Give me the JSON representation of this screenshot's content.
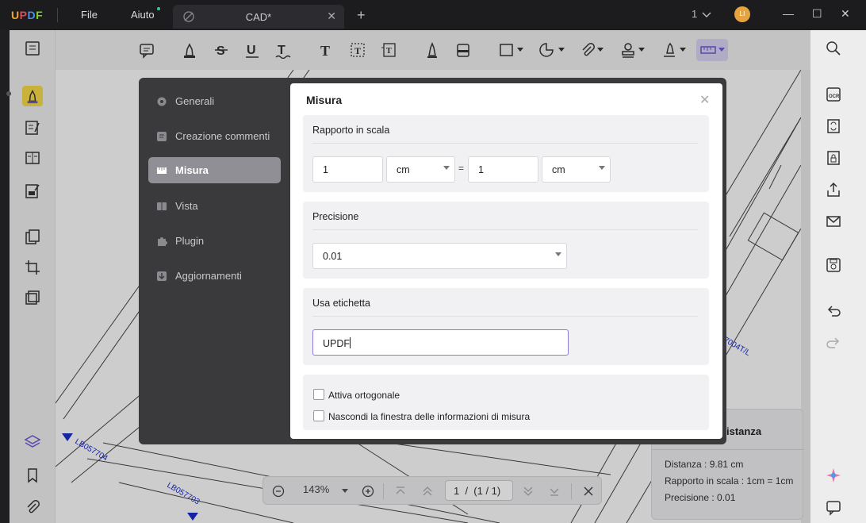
{
  "titlebar": {
    "logo": [
      "U",
      "P",
      "D",
      "F"
    ],
    "menu": [
      "File",
      "Aiuto"
    ],
    "tab_title": "CAD*",
    "page_indicator": "1",
    "avatar_initials": "LI"
  },
  "settings": {
    "nav": [
      {
        "label": "Generali"
      },
      {
        "label": "Creazione commenti"
      },
      {
        "label": "Misura"
      },
      {
        "label": "Vista"
      },
      {
        "label": "Plugin"
      },
      {
        "label": "Aggiornamenti"
      }
    ],
    "active": "Misura"
  },
  "misura": {
    "title": "Misura",
    "scale_section": "Rapporto in scala",
    "scale_left_value": "1",
    "scale_left_unit": "cm",
    "equals": "=",
    "scale_right_value": "1",
    "scale_right_unit": "cm",
    "precision_section": "Precisione",
    "precision_value": "0.01",
    "label_section": "Usa etichetta",
    "label_value": "UPDF",
    "checkbox_orthogonal": "Attiva ortogonale",
    "checkbox_hide_info": "Nascondi la finestra delle informazioni di misura"
  },
  "info_panel": {
    "title": "istanza",
    "distance": "Distanza : 9.81 cm",
    "scale": "Rapporto in scala : 1cm = 1cm",
    "precision": "Precisione : 0.01"
  },
  "bottomnav": {
    "zoom": "143%",
    "page": "1  /  (1 / 1)"
  },
  "colors": {
    "accent": "#8a7bd8",
    "dialog_bg": "#3a3a3d",
    "active_nav": "#8f8f95"
  }
}
